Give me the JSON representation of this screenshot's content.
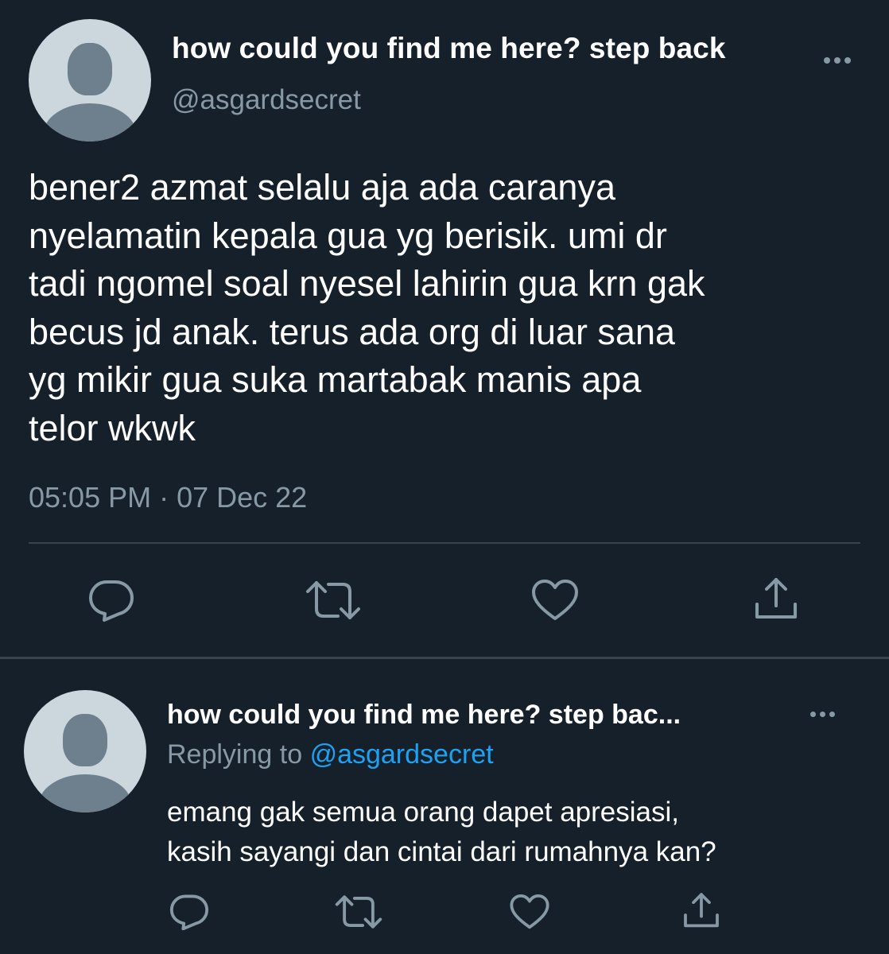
{
  "main_tweet": {
    "display_name": "how could you find me here? step back",
    "handle": "@asgardsecret",
    "text": "bener2 azmat selalu aja ada caranya\nnyelamatin kepala gua yg berisik. umi dr\ntadi ngomel soal nyesel lahirin gua krn gak\nbecus jd anak. terus ada org di luar sana\nyg mikir gua suka martabak manis apa\ntelor wkwk",
    "timestamp": "05:05 PM · 07 Dec 22",
    "actions": [
      "reply-icon",
      "retweet-icon",
      "like-icon",
      "share-icon"
    ]
  },
  "reply_tweet": {
    "display_name": "how could you find me here? step bac...",
    "replying_prefix": "Replying to",
    "replying_to": "@asgardsecret",
    "text": "emang gak semua orang dapet apresiasi,\nkasih sayangi dan cintai dari rumahnya kan?",
    "actions": [
      "reply-icon",
      "retweet-icon",
      "like-icon",
      "share-icon"
    ]
  },
  "colors": {
    "background": "#15202b",
    "primary_text": "#ffffff",
    "secondary_text": "#8899a6",
    "link": "#1da1f2",
    "divider": "#38444d",
    "avatar_bg": "#ccd6dd",
    "avatar_fg": "#6e7f8d"
  }
}
